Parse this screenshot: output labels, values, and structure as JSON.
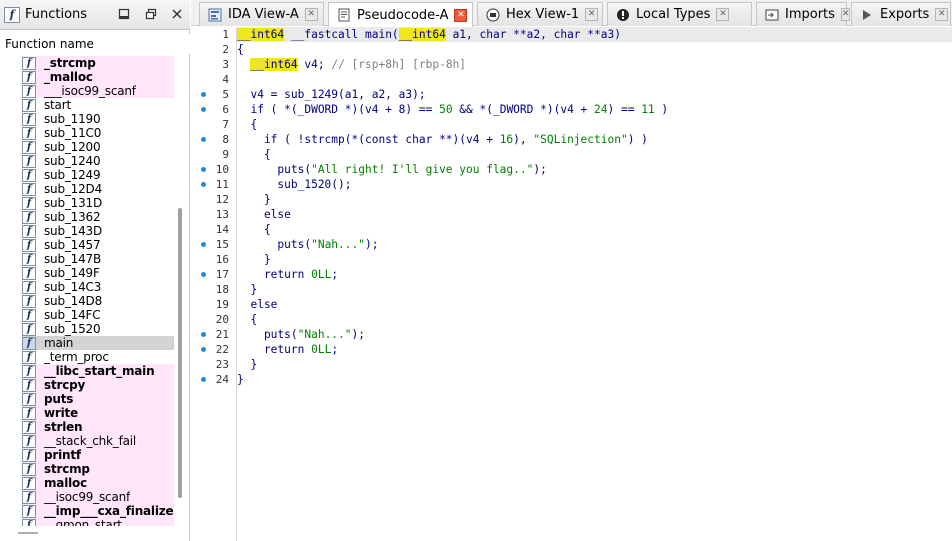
{
  "functions_panel": {
    "title": "Functions",
    "column_header": "Function name",
    "icon_glyph": "f",
    "items": [
      {
        "name": "_strcmp",
        "lib": true,
        "bold": true,
        "selected": false
      },
      {
        "name": "_malloc",
        "lib": true,
        "bold": true,
        "selected": false
      },
      {
        "name": "___isoc99_scanf",
        "lib": true,
        "bold": false,
        "selected": false
      },
      {
        "name": "start",
        "lib": false,
        "bold": false,
        "selected": false
      },
      {
        "name": "sub_1190",
        "lib": false,
        "bold": false,
        "selected": false
      },
      {
        "name": "sub_11C0",
        "lib": false,
        "bold": false,
        "selected": false
      },
      {
        "name": "sub_1200",
        "lib": false,
        "bold": false,
        "selected": false
      },
      {
        "name": "sub_1240",
        "lib": false,
        "bold": false,
        "selected": false
      },
      {
        "name": "sub_1249",
        "lib": false,
        "bold": false,
        "selected": false
      },
      {
        "name": "sub_12D4",
        "lib": false,
        "bold": false,
        "selected": false
      },
      {
        "name": "sub_131D",
        "lib": false,
        "bold": false,
        "selected": false
      },
      {
        "name": "sub_1362",
        "lib": false,
        "bold": false,
        "selected": false
      },
      {
        "name": "sub_143D",
        "lib": false,
        "bold": false,
        "selected": false
      },
      {
        "name": "sub_1457",
        "lib": false,
        "bold": false,
        "selected": false
      },
      {
        "name": "sub_147B",
        "lib": false,
        "bold": false,
        "selected": false
      },
      {
        "name": "sub_149F",
        "lib": false,
        "bold": false,
        "selected": false
      },
      {
        "name": "sub_14C3",
        "lib": false,
        "bold": false,
        "selected": false
      },
      {
        "name": "sub_14D8",
        "lib": false,
        "bold": false,
        "selected": false
      },
      {
        "name": "sub_14FC",
        "lib": false,
        "bold": false,
        "selected": false
      },
      {
        "name": "sub_1520",
        "lib": false,
        "bold": false,
        "selected": false
      },
      {
        "name": "main",
        "lib": false,
        "bold": false,
        "selected": true
      },
      {
        "name": "_term_proc",
        "lib": false,
        "bold": false,
        "selected": false
      },
      {
        "name": "__libc_start_main",
        "lib": true,
        "bold": true,
        "selected": false
      },
      {
        "name": "strcpy",
        "lib": true,
        "bold": true,
        "selected": false
      },
      {
        "name": "puts",
        "lib": true,
        "bold": true,
        "selected": false
      },
      {
        "name": "write",
        "lib": true,
        "bold": true,
        "selected": false
      },
      {
        "name": "strlen",
        "lib": true,
        "bold": true,
        "selected": false
      },
      {
        "name": "__stack_chk_fail",
        "lib": true,
        "bold": false,
        "selected": false
      },
      {
        "name": "printf",
        "lib": true,
        "bold": true,
        "selected": false
      },
      {
        "name": "strcmp",
        "lib": true,
        "bold": true,
        "selected": false
      },
      {
        "name": "malloc",
        "lib": true,
        "bold": true,
        "selected": false
      },
      {
        "name": "__isoc99_scanf",
        "lib": true,
        "bold": false,
        "selected": false
      },
      {
        "name": "__imp___cxa_finalize",
        "lib": true,
        "bold": true,
        "selected": false
      },
      {
        "name": "__gmon_start__",
        "lib": true,
        "bold": false,
        "selected": false
      }
    ]
  },
  "tabs": [
    {
      "label": "IDA View-A",
      "icon": "graph-view-icon",
      "active": false
    },
    {
      "label": "Pseudocode-A",
      "icon": "pseudocode-icon",
      "active": true
    },
    {
      "label": "Hex View-1",
      "icon": "hex-view-icon",
      "active": false
    },
    {
      "label": "Local Types",
      "icon": "local-types-icon",
      "active": false
    },
    {
      "label": "Imports",
      "icon": "imports-icon",
      "active": false
    },
    {
      "label": "Exports",
      "icon": "exports-icon",
      "active": false
    }
  ],
  "pseudocode": {
    "lines": [
      {
        "num": "1",
        "bp": false,
        "tokens": [
          {
            "t": "__int64",
            "c": "kw",
            "hl": true
          },
          {
            "t": " __fastcall main(",
            "c": "fn"
          },
          {
            "t": "__int64",
            "c": "kw",
            "hl": true
          },
          {
            "t": " a1, char **a2, char **a3)",
            "c": "var"
          }
        ]
      },
      {
        "num": "2",
        "bp": false,
        "tokens": [
          {
            "t": "{",
            "c": "fn"
          }
        ]
      },
      {
        "num": "3",
        "bp": false,
        "tokens": [
          {
            "t": "  ",
            "c": "fn"
          },
          {
            "t": "__int64",
            "c": "kw",
            "hl": true
          },
          {
            "t": " v4; ",
            "c": "var"
          },
          {
            "t": "// [rsp+8h] [rbp-8h]",
            "c": "cmt"
          }
        ]
      },
      {
        "num": "4",
        "bp": false,
        "tokens": []
      },
      {
        "num": "5",
        "bp": true,
        "tokens": [
          {
            "t": "  v4 = sub_1249(a1, a2, a3);",
            "c": "fn"
          }
        ]
      },
      {
        "num": "6",
        "bp": true,
        "tokens": [
          {
            "t": "  if ( *(_DWORD *)(v4 + 8) == ",
            "c": "fn"
          },
          {
            "t": "50",
            "c": "num"
          },
          {
            "t": " && *(_DWORD *)(v4 + ",
            "c": "fn"
          },
          {
            "t": "24",
            "c": "num"
          },
          {
            "t": ") == ",
            "c": "fn"
          },
          {
            "t": "11",
            "c": "num"
          },
          {
            "t": " )",
            "c": "fn"
          }
        ]
      },
      {
        "num": "7",
        "bp": false,
        "tokens": [
          {
            "t": "  {",
            "c": "fn"
          }
        ]
      },
      {
        "num": "8",
        "bp": true,
        "tokens": [
          {
            "t": "    if ( !strcmp(*(const char **)(v4 + ",
            "c": "fn"
          },
          {
            "t": "16",
            "c": "num"
          },
          {
            "t": "), ",
            "c": "fn"
          },
          {
            "t": "\"SQLinjection\"",
            "c": "str"
          },
          {
            "t": ") )",
            "c": "fn"
          }
        ]
      },
      {
        "num": "9",
        "bp": false,
        "tokens": [
          {
            "t": "    {",
            "c": "fn"
          }
        ]
      },
      {
        "num": "10",
        "bp": true,
        "tokens": [
          {
            "t": "      puts(",
            "c": "fn"
          },
          {
            "t": "\"All right! I'll give you flag..\"",
            "c": "str"
          },
          {
            "t": ");",
            "c": "fn"
          }
        ]
      },
      {
        "num": "11",
        "bp": true,
        "tokens": [
          {
            "t": "      sub_1520();",
            "c": "fn"
          }
        ]
      },
      {
        "num": "12",
        "bp": false,
        "tokens": [
          {
            "t": "    }",
            "c": "fn"
          }
        ]
      },
      {
        "num": "13",
        "bp": false,
        "tokens": [
          {
            "t": "    else",
            "c": "fn"
          }
        ]
      },
      {
        "num": "14",
        "bp": false,
        "tokens": [
          {
            "t": "    {",
            "c": "fn"
          }
        ]
      },
      {
        "num": "15",
        "bp": true,
        "tokens": [
          {
            "t": "      puts(",
            "c": "fn"
          },
          {
            "t": "\"Nah...\"",
            "c": "str"
          },
          {
            "t": ");",
            "c": "fn"
          }
        ]
      },
      {
        "num": "16",
        "bp": false,
        "tokens": [
          {
            "t": "    }",
            "c": "fn"
          }
        ]
      },
      {
        "num": "17",
        "bp": true,
        "tokens": [
          {
            "t": "    return ",
            "c": "fn"
          },
          {
            "t": "0LL",
            "c": "num"
          },
          {
            "t": ";",
            "c": "fn"
          }
        ]
      },
      {
        "num": "18",
        "bp": false,
        "tokens": [
          {
            "t": "  }",
            "c": "fn"
          }
        ]
      },
      {
        "num": "19",
        "bp": false,
        "tokens": [
          {
            "t": "  else",
            "c": "fn"
          }
        ]
      },
      {
        "num": "20",
        "bp": false,
        "tokens": [
          {
            "t": "  {",
            "c": "fn"
          }
        ]
      },
      {
        "num": "21",
        "bp": true,
        "tokens": [
          {
            "t": "    puts(",
            "c": "fn"
          },
          {
            "t": "\"Nah...\"",
            "c": "str"
          },
          {
            "t": ");",
            "c": "fn"
          }
        ]
      },
      {
        "num": "22",
        "bp": true,
        "tokens": [
          {
            "t": "    return ",
            "c": "fn"
          },
          {
            "t": "0LL",
            "c": "num"
          },
          {
            "t": ";",
            "c": "fn"
          }
        ]
      },
      {
        "num": "23",
        "bp": false,
        "tokens": [
          {
            "t": "  }",
            "c": "fn"
          }
        ]
      },
      {
        "num": "24",
        "bp": true,
        "tokens": [
          {
            "t": "}",
            "c": "fn"
          }
        ]
      }
    ]
  },
  "colors": {
    "lib_function_bg": "#ffe6fb",
    "keyword_highlight": "#f0e61c",
    "string": "#008000",
    "comment": "#808080",
    "code_text": "#000080",
    "breakpoint_dot": "#1f8bd8",
    "active_tab_close": "#f05a3c"
  }
}
